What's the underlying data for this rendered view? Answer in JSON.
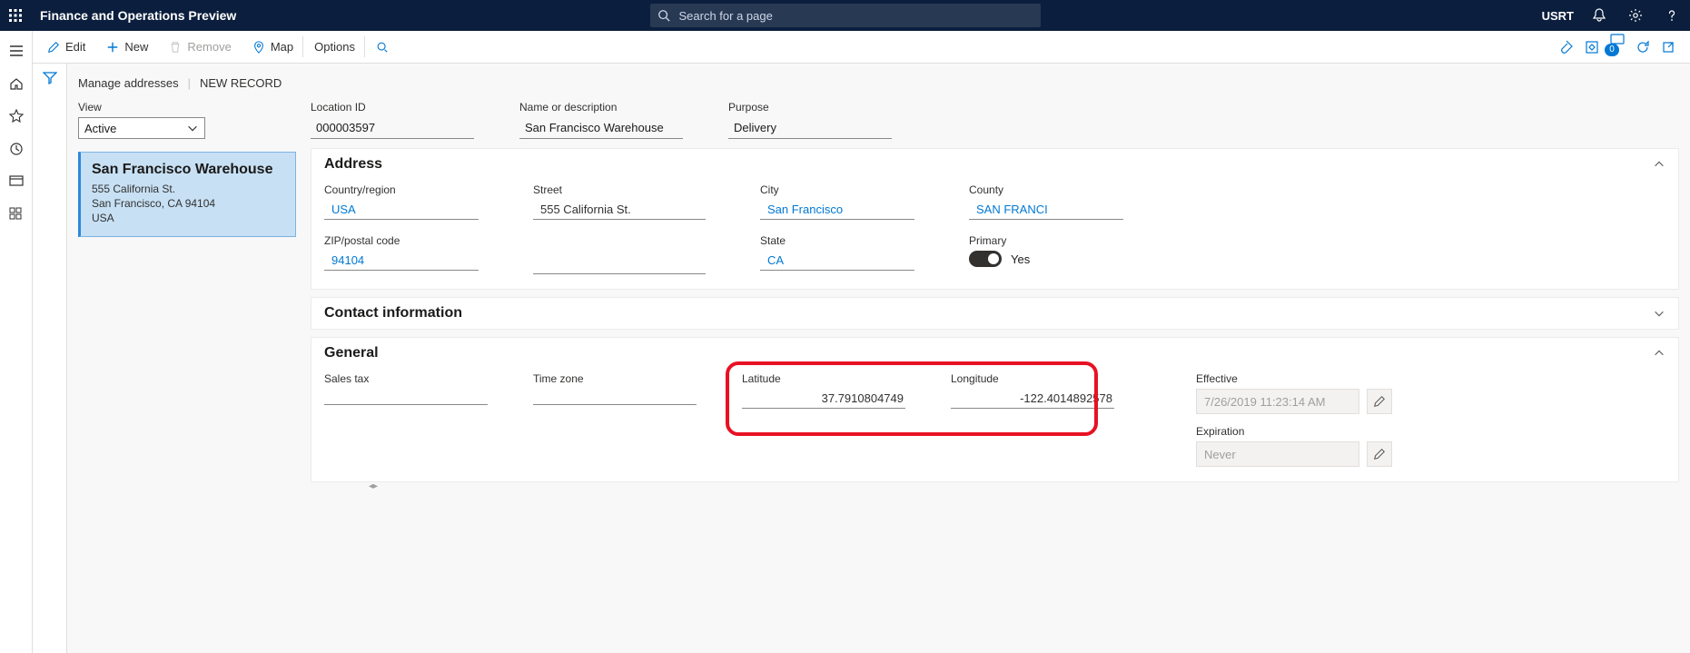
{
  "app_title": "Finance and Operations Preview",
  "search_placeholder": "Search for a page",
  "user": "USRT",
  "actions": {
    "edit": "Edit",
    "new": "New",
    "remove": "Remove",
    "map": "Map",
    "options": "Options"
  },
  "badge_count": "0",
  "breadcrumb": {
    "a": "Manage addresses",
    "b": "NEW RECORD"
  },
  "left": {
    "view_label": "View",
    "view_value": "Active",
    "card": {
      "title": "San Francisco Warehouse",
      "line1": "555 California St.",
      "line2": "San Francisco, CA 94104",
      "line3": "USA"
    }
  },
  "header": {
    "location_id_label": "Location ID",
    "location_id": "000003597",
    "name_label": "Name or description",
    "name": "San Francisco Warehouse",
    "purpose_label": "Purpose",
    "purpose": "Delivery"
  },
  "sections": {
    "address": "Address",
    "contact": "Contact information",
    "general": "General"
  },
  "address": {
    "country_label": "Country/region",
    "country": "USA",
    "zip_label": "ZIP/postal code",
    "zip": "94104",
    "street_label": "Street",
    "street": "555 California St.",
    "city_label": "City",
    "city": "San Francisco",
    "state_label": "State",
    "state": "CA",
    "county_label": "County",
    "county": "SAN FRANCI",
    "primary_label": "Primary",
    "primary_text": "Yes"
  },
  "general": {
    "salestax_label": "Sales tax",
    "timezone_label": "Time zone",
    "lat_label": "Latitude",
    "lat": "37.7910804749",
    "lon_label": "Longitude",
    "lon": "-122.4014892578",
    "effective_label": "Effective",
    "effective": "7/26/2019 11:23:14 AM",
    "expiration_label": "Expiration",
    "expiration": "Never"
  }
}
